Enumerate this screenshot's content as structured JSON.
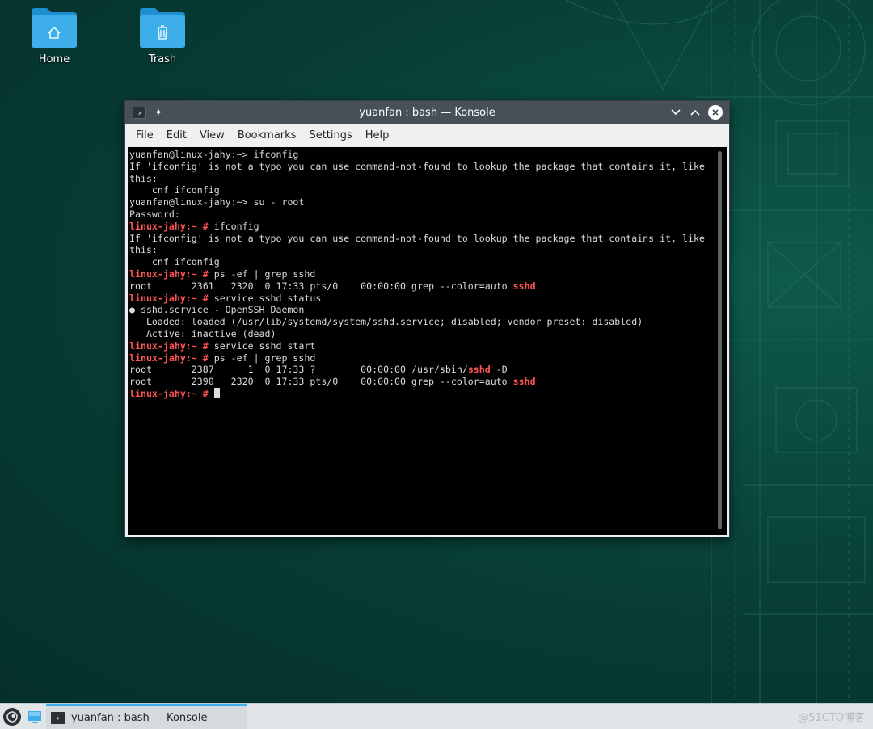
{
  "desktop": {
    "icons": [
      {
        "label": "Home"
      },
      {
        "label": "Trash"
      }
    ]
  },
  "window": {
    "title": "yuanfan : bash — Konsole",
    "menu": [
      "File",
      "Edit",
      "View",
      "Bookmarks",
      "Settings",
      "Help"
    ]
  },
  "terminal": {
    "lines": [
      [
        {
          "t": "yuanfan@linux-jahy:~> ifconfig"
        }
      ],
      [
        {
          "t": "If 'ifconfig' is not a typo you can use command-not-found to lookup the package that contains it, like"
        }
      ],
      [
        {
          "t": "this:"
        }
      ],
      [
        {
          "t": "    cnf ifconfig"
        }
      ],
      [
        {
          "t": "yuanfan@linux-jahy:~> su - root"
        }
      ],
      [
        {
          "t": "Password:"
        }
      ],
      [
        {
          "t": "linux-jahy:~ #",
          "c": "red"
        },
        {
          "t": " ifconfig"
        }
      ],
      [
        {
          "t": "If 'ifconfig' is not a typo you can use command-not-found to lookup the package that contains it, like"
        }
      ],
      [
        {
          "t": "this:"
        }
      ],
      [
        {
          "t": "    cnf ifconfig"
        }
      ],
      [
        {
          "t": "linux-jahy:~ #",
          "c": "red"
        },
        {
          "t": " ps -ef | grep sshd"
        }
      ],
      [
        {
          "t": "root       2361   2320  0 17:33 pts/0    00:00:00 grep --color=auto "
        },
        {
          "t": "sshd",
          "c": "red"
        }
      ],
      [
        {
          "t": "linux-jahy:~ #",
          "c": "red"
        },
        {
          "t": " service sshd status"
        }
      ],
      [
        {
          "t": "● sshd.service - OpenSSH Daemon"
        }
      ],
      [
        {
          "t": "   Loaded: loaded (/usr/lib/systemd/system/sshd.service; disabled; vendor preset: disabled)"
        }
      ],
      [
        {
          "t": "   Active: inactive (dead)"
        }
      ],
      [
        {
          "t": "linux-jahy:~ #",
          "c": "red"
        },
        {
          "t": " service sshd start"
        }
      ],
      [
        {
          "t": "linux-jahy:~ #",
          "c": "red"
        },
        {
          "t": " ps -ef | grep sshd"
        }
      ],
      [
        {
          "t": "root       2387      1  0 17:33 ?        00:00:00 /usr/sbin/"
        },
        {
          "t": "sshd",
          "c": "red"
        },
        {
          "t": " -D"
        }
      ],
      [
        {
          "t": "root       2390   2320  0 17:33 pts/0    00:00:00 grep --color=auto "
        },
        {
          "t": "sshd",
          "c": "red"
        }
      ],
      [
        {
          "t": "linux-jahy:~ #",
          "c": "red"
        },
        {
          "t": " "
        },
        {
          "cursor": true
        }
      ]
    ]
  },
  "taskbar": {
    "task_label": "yuanfan : bash — Konsole",
    "watermark": "@51CTO博客"
  },
  "colors": {
    "prompt_red": "#ff5454",
    "accent": "#3daee9",
    "folder": "#3daee9"
  }
}
